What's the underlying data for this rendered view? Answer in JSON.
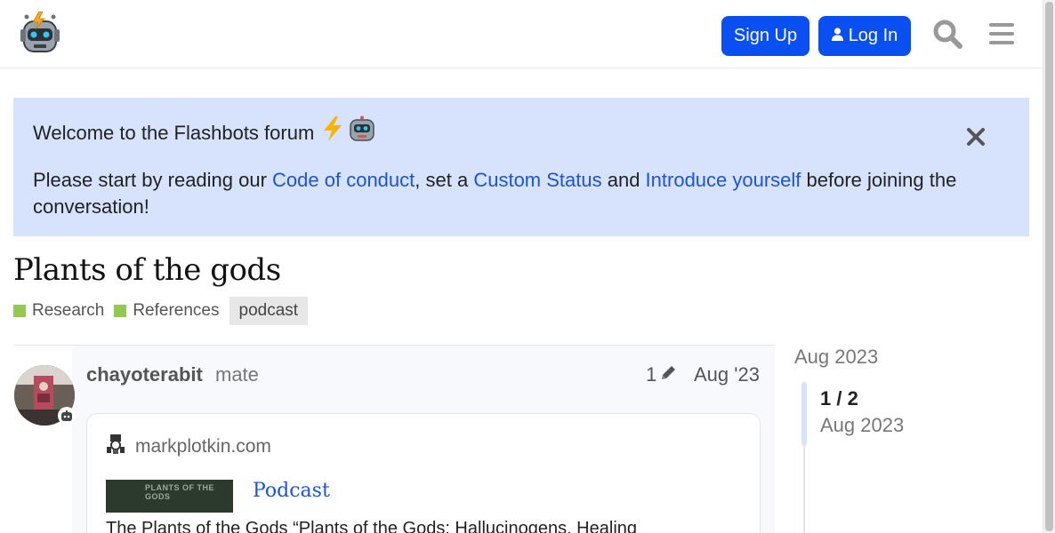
{
  "header": {
    "signup_label": "Sign Up",
    "login_label": "Log In",
    "accent": "#0a4ff2"
  },
  "banner": {
    "title": "Welcome to the Flashbots forum",
    "title_icons": [
      "lightning-icon",
      "robot-icon"
    ],
    "text_before": "Please start by reading our ",
    "link_conduct": "Code of conduct",
    "text_mid1": ", set a ",
    "link_status": "Custom Status",
    "text_mid2": " and ",
    "link_introduce": "Introduce yourself",
    "text_after": " before joining the conversation!",
    "background": "#d7e2fd"
  },
  "topic": {
    "title": "Plants of the gods",
    "categories": [
      {
        "label": "Research",
        "color": "#92c952"
      },
      {
        "label": "References",
        "color": "#92c952"
      }
    ],
    "tags": [
      "podcast"
    ]
  },
  "post": {
    "username": "chayoterabit",
    "user_title": "mate",
    "edit_count": "1",
    "date": "Aug '23",
    "onebox": {
      "source": "markplotkin.com",
      "thumb_text": "PLANTS OF THE GODS",
      "title": "Podcast",
      "excerpt": "The Plants of the Gods “Plants of the Gods: Hallucinogens, Healing"
    }
  },
  "timeline": {
    "start_date": "Aug 2023",
    "position": "1 / 2",
    "current_date": "Aug 2023",
    "progress": 0.5
  }
}
